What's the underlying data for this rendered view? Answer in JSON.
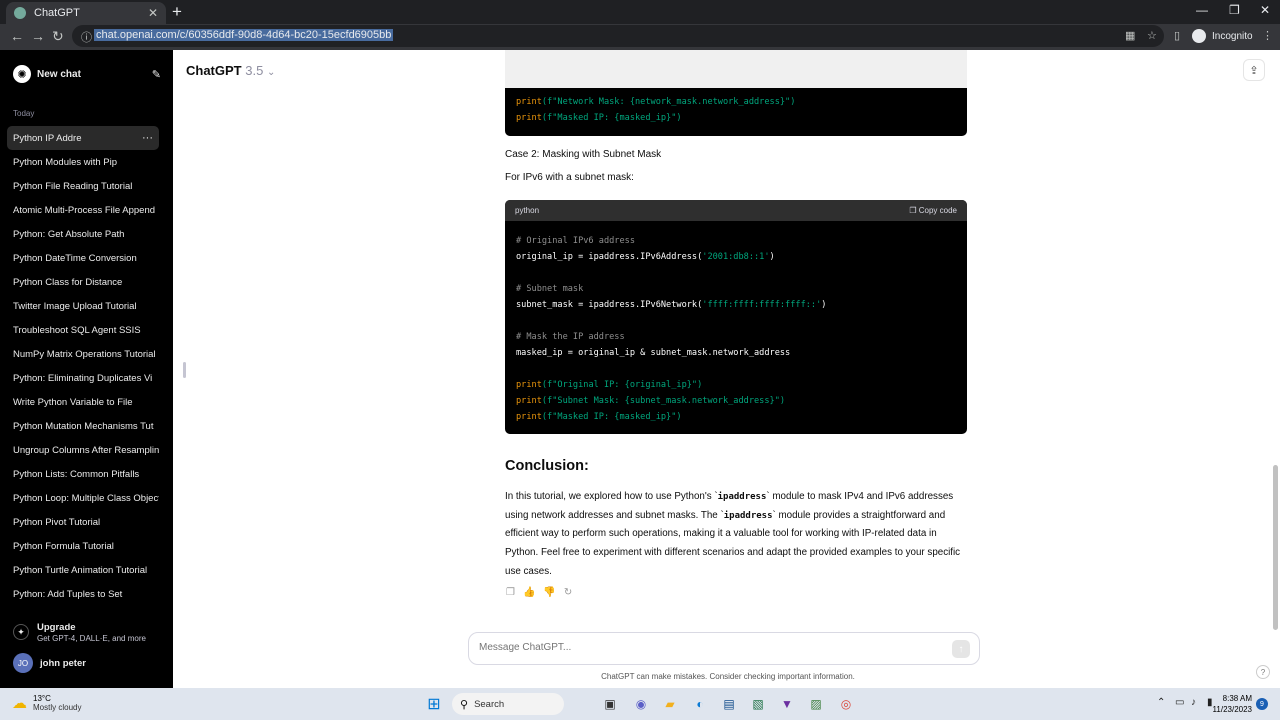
{
  "browser": {
    "tab_title": "ChatGPT",
    "url": "chat.openai.com/c/60356ddf-90d8-4d64-bc20-15ecfd6905bb",
    "incognito_label": "Incognito"
  },
  "sidebar": {
    "new_chat": "New chat",
    "section": "Today",
    "items": [
      {
        "label": "Python IP Addre",
        "active": true
      },
      {
        "label": "Python Modules with Pip"
      },
      {
        "label": "Python File Reading Tutorial"
      },
      {
        "label": "Atomic Multi-Process File Append"
      },
      {
        "label": "Python: Get Absolute Path"
      },
      {
        "label": "Python DateTime Conversion"
      },
      {
        "label": "Python Class for Distance"
      },
      {
        "label": "Twitter Image Upload Tutorial"
      },
      {
        "label": "Troubleshoot SQL Agent SSIS"
      },
      {
        "label": "NumPy Matrix Operations Tutorial"
      },
      {
        "label": "Python: Eliminating Duplicates Vi"
      },
      {
        "label": "Write Python Variable to File"
      },
      {
        "label": "Python Mutation Mechanisms Tut"
      },
      {
        "label": "Ungroup Columns After Resampling"
      },
      {
        "label": "Python Lists: Common Pitfalls"
      },
      {
        "label": "Python Loop: Multiple Class Objects"
      },
      {
        "label": "Python Pivot Tutorial"
      },
      {
        "label": "Python Formula Tutorial"
      },
      {
        "label": "Python Turtle Animation Tutorial"
      },
      {
        "label": "Python: Add Tuples to Set"
      }
    ],
    "upgrade_title": "Upgrade",
    "upgrade_sub": "Get GPT-4, DALL·E, and more",
    "user_initials": "JO",
    "user_name": "john peter"
  },
  "header": {
    "model": "ChatGPT",
    "version": "3.5"
  },
  "content": {
    "top_code": {
      "line1_fn": "print",
      "line1_str": "(f\"Network Mask: {network_mask.network_address}\")",
      "line2_fn": "print",
      "line2_str": "(f\"Masked IP: {masked_ip}\")"
    },
    "case2": "Case 2: Masking with Subnet Mask",
    "ipv6_intro": "For IPv6 with a subnet mask:",
    "codeblock": {
      "lang": "python",
      "copy_label": "Copy code",
      "c1": "# Original IPv6 address",
      "l2a": "original_ip = ipaddress.IPv6Address(",
      "l2s": "'2001:db8::1'",
      "l2b": ")",
      "c3": "# Subnet mask",
      "l4a": "subnet_mask = ipaddress.IPv6Network(",
      "l4s": "'ffff:ffff:ffff:ffff::'",
      "l4b": ")",
      "c5": "# Mask the IP address",
      "l6": "masked_ip = original_ip & subnet_mask.network_address",
      "p1fn": "print",
      "p1s": "(f\"Original IP: {original_ip}\")",
      "p2fn": "print",
      "p2s": "(f\"Subnet Mask: {subnet_mask.network_address}\")",
      "p3fn": "print",
      "p3s": "(f\"Masked IP: {masked_ip}\")"
    },
    "conclusion_title": "Conclusion:",
    "conclusion_p1": "In this tutorial, we explored how to use Python's `",
    "conclusion_code1": "ipaddress",
    "conclusion_p2": "` module to mask IPv4 and IPv6 addresses using network addresses and subnet masks. The `",
    "conclusion_code2": "ipaddress",
    "conclusion_p3": "` module provides a straightforward and efficient way to perform such operations, making it a valuable tool for working with IP-related data in Python. Feel free to experiment with different scenarios and adapt the provided examples to your specific use cases."
  },
  "composer": {
    "placeholder": "Message ChatGPT...",
    "disclaimer": "ChatGPT can make mistakes. Consider checking important information."
  },
  "taskbar": {
    "temp": "13°C",
    "weather": "Mostly cloudy",
    "search": "Search",
    "time": "8:38 AM",
    "date": "11/23/2023",
    "notifications": "9"
  }
}
